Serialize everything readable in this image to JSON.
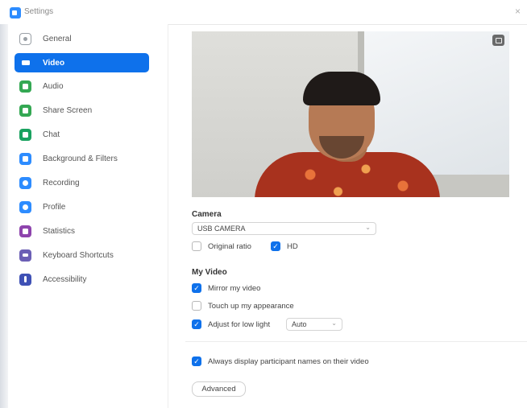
{
  "window": {
    "title": "Settings",
    "close_glyph": "×"
  },
  "sidebar": {
    "items": [
      {
        "label": "General",
        "icon": "gear-icon",
        "color": "#ffffff",
        "border": "#9aa0a6"
      },
      {
        "label": "Video",
        "icon": "video-camera-icon",
        "color": "#0e71eb",
        "active": true
      },
      {
        "label": "Audio",
        "icon": "headphones-icon",
        "color": "#34a853"
      },
      {
        "label": "Share Screen",
        "icon": "share-screen-icon",
        "color": "#34a853"
      },
      {
        "label": "Chat",
        "icon": "chat-bubble-icon",
        "color": "#1aa260"
      },
      {
        "label": "Background & Filters",
        "icon": "background-icon",
        "color": "#2d8cff"
      },
      {
        "label": "Recording",
        "icon": "recording-icon",
        "color": "#2d8cff"
      },
      {
        "label": "Profile",
        "icon": "profile-icon",
        "color": "#2d8cff"
      },
      {
        "label": "Statistics",
        "icon": "statistics-icon",
        "color": "#8e44ad"
      },
      {
        "label": "Keyboard Shortcuts",
        "icon": "keyboard-icon",
        "color": "#6b5fb5"
      },
      {
        "label": "Accessibility",
        "icon": "accessibility-icon",
        "color": "#3f51b5"
      }
    ]
  },
  "camera": {
    "label": "Camera",
    "selected": "USB CAMERA",
    "original_ratio_label": "Original ratio",
    "original_ratio_checked": false,
    "hd_label": "HD",
    "hd_checked": true
  },
  "my_video": {
    "label": "My Video",
    "mirror_label": "Mirror my video",
    "mirror_checked": true,
    "touch_up_label": "Touch up my appearance",
    "touch_up_checked": false,
    "low_light_label": "Adjust for low light",
    "low_light_checked": true,
    "low_light_mode": "Auto"
  },
  "participants": {
    "always_display_label": "Always display participant names on their video",
    "always_display_checked": true
  },
  "advanced_label": "Advanced",
  "check_glyph": "✓",
  "chevron_glyph": "⌄",
  "colors": {
    "accent": "#0e71eb"
  }
}
